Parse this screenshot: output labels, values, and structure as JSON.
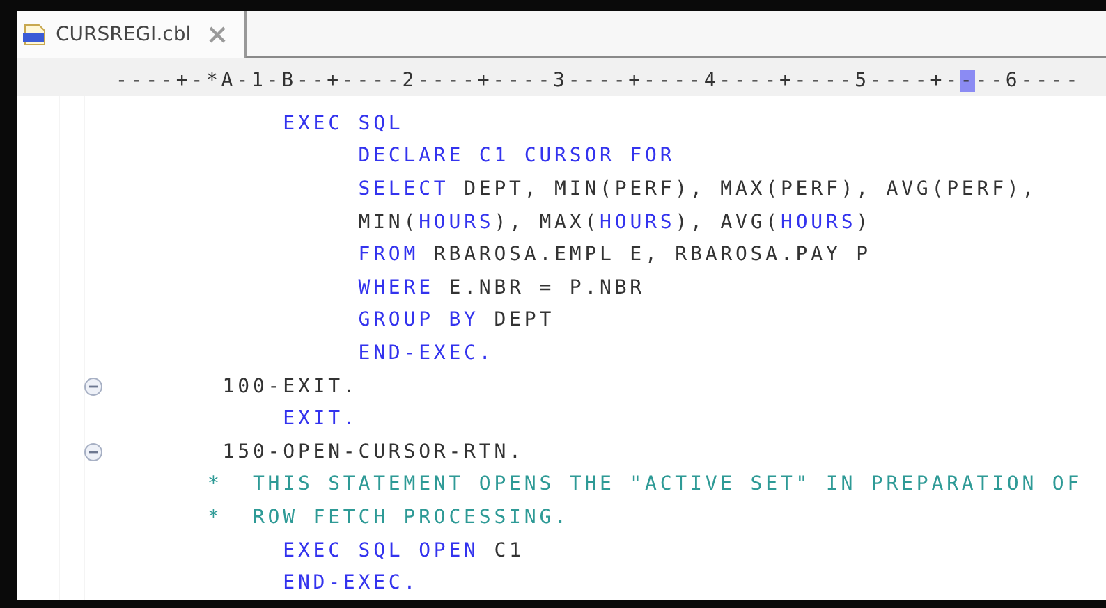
{
  "tab": {
    "title": "CURSREGI.cbl",
    "selected": true
  },
  "ruler": {
    "before": "----+-*A-1-B--+----2----+----3----+----4----+----5----+-",
    "cursor": "-",
    "after": "--6----"
  },
  "lines": [
    {
      "folding": false,
      "segments": [
        {
          "kind": "keyword",
          "text": "           EXEC SQL"
        }
      ]
    },
    {
      "folding": false,
      "segments": [
        {
          "kind": "keyword",
          "text": "                DECLARE C1 CURSOR FOR"
        }
      ]
    },
    {
      "folding": false,
      "segments": [
        {
          "kind": "keyword",
          "text": "                SELECT"
        },
        {
          "kind": "plain",
          "text": " DEPT, MIN(PERF), MAX(PERF), AVG(PERF),"
        }
      ]
    },
    {
      "folding": false,
      "segments": [
        {
          "kind": "plain",
          "text": "                MIN("
        },
        {
          "kind": "keyword",
          "text": "HOURS"
        },
        {
          "kind": "plain",
          "text": "), MAX("
        },
        {
          "kind": "keyword",
          "text": "HOURS"
        },
        {
          "kind": "plain",
          "text": "), AVG("
        },
        {
          "kind": "keyword",
          "text": "HOURS"
        },
        {
          "kind": "plain",
          "text": ")"
        }
      ]
    },
    {
      "folding": false,
      "segments": [
        {
          "kind": "keyword",
          "text": "                FROM"
        },
        {
          "kind": "plain",
          "text": " RBAROSA.EMPL E, RBAROSA.PAY P"
        }
      ]
    },
    {
      "folding": false,
      "segments": [
        {
          "kind": "keyword",
          "text": "                WHERE"
        },
        {
          "kind": "plain",
          "text": " E.NBR = P.NBR"
        }
      ]
    },
    {
      "folding": false,
      "segments": [
        {
          "kind": "keyword",
          "text": "                GROUP BY"
        },
        {
          "kind": "plain",
          "text": " DEPT"
        }
      ]
    },
    {
      "folding": false,
      "segments": [
        {
          "kind": "keyword",
          "text": "                END-EXEC."
        }
      ]
    },
    {
      "folding": true,
      "segments": [
        {
          "kind": "plain",
          "text": "       100-EXIT."
        }
      ]
    },
    {
      "folding": false,
      "segments": [
        {
          "kind": "keyword",
          "text": "           EXIT."
        }
      ]
    },
    {
      "folding": true,
      "segments": [
        {
          "kind": "plain",
          "text": "       150-OPEN-CURSOR-RTN."
        }
      ]
    },
    {
      "folding": false,
      "segments": [
        {
          "kind": "comment",
          "text": "      *  THIS STATEMENT OPENS THE \"ACTIVE SET\" IN PREPARATION OF"
        }
      ]
    },
    {
      "folding": false,
      "segments": [
        {
          "kind": "comment",
          "text": "      *  ROW FETCH PROCESSING."
        }
      ]
    },
    {
      "folding": false,
      "segments": [
        {
          "kind": "keyword",
          "text": "           EXEC SQL OPEN"
        },
        {
          "kind": "plain",
          "text": " C1"
        }
      ]
    },
    {
      "folding": false,
      "segments": [
        {
          "kind": "keyword",
          "text": "           END-EXEC."
        }
      ]
    }
  ]
}
